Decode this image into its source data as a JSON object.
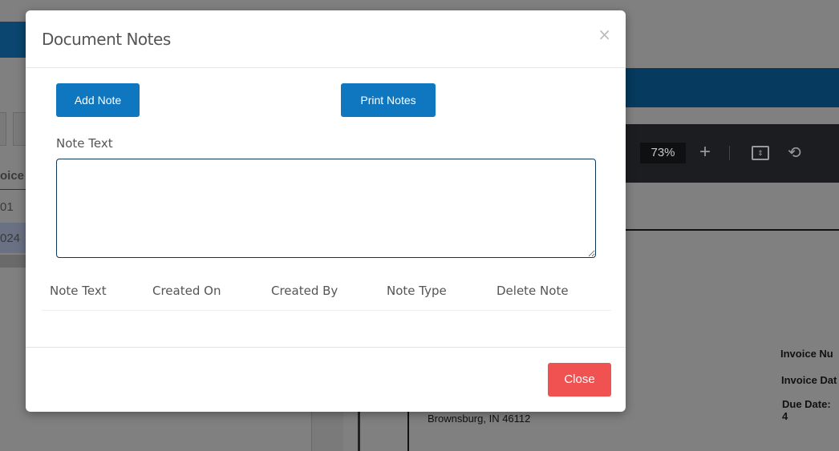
{
  "background": {
    "zoom_level": "73%",
    "left_table": {
      "header_fragment": "oice",
      "rows": [
        "01",
        "024"
      ]
    },
    "document": {
      "invoice_number_label": "Invoice Nu",
      "invoice_date_label": "Invoice Dat",
      "due_date_label": "Due Date: 4",
      "address_line": "Brownsburg, IN 46112"
    }
  },
  "modal": {
    "title": "Document Notes",
    "close_x": "×",
    "add_note_label": "Add Note",
    "print_notes_label": "Print Notes",
    "note_text_label": "Note Text",
    "note_text_value": "",
    "table": {
      "columns": [
        "Note Text",
        "Created On",
        "Created By",
        "Note Type",
        "Delete Note"
      ],
      "rows": []
    },
    "close_label": "Close"
  },
  "colors": {
    "primary": "#0f77c0",
    "danger": "#f05252",
    "header_blue": "#063a5e"
  }
}
